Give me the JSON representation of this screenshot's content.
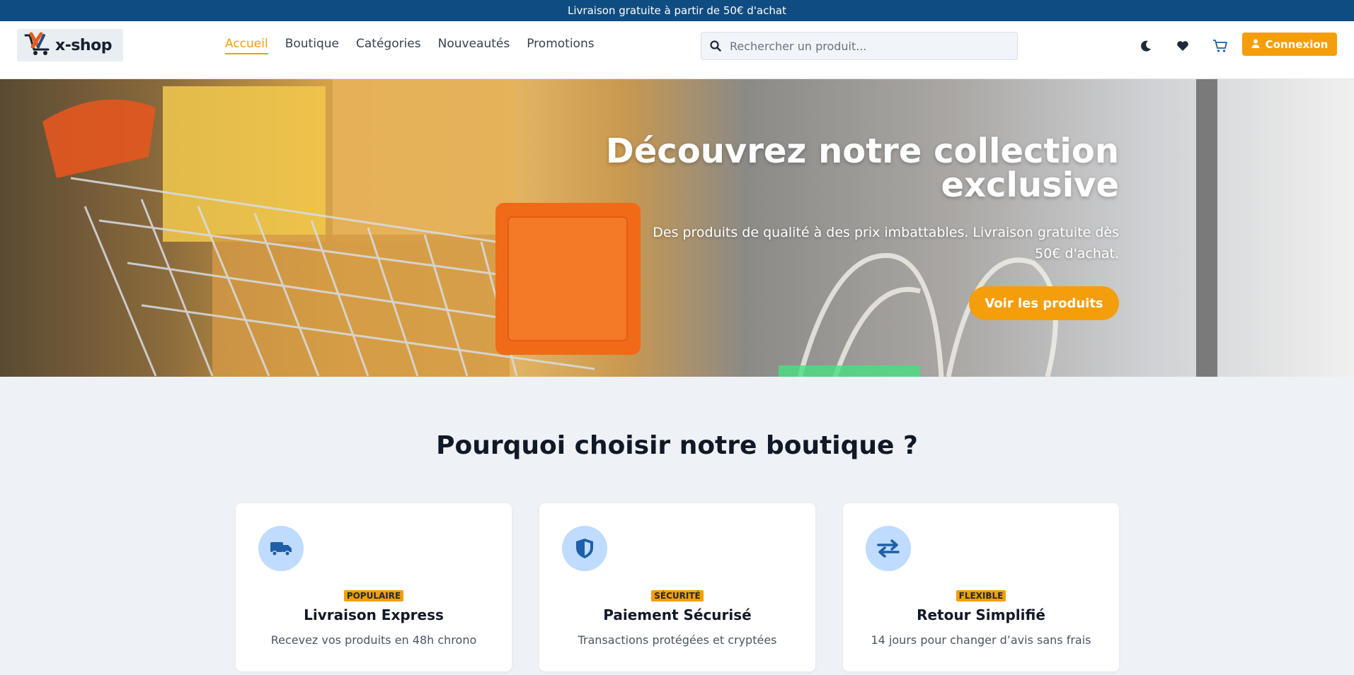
{
  "topbar": {
    "text": "Livraison gratuite à partir de 50€ d'achat"
  },
  "header": {
    "logo_text": "x-shop",
    "nav": [
      "Accueil",
      "Boutique",
      "Catégories",
      "Nouveautés",
      "Promotions"
    ],
    "active_nav": "Accueil",
    "search_placeholder": "Rechercher un produit...",
    "login_label": "Connexion",
    "icons": [
      "moon-icon",
      "heart-icon",
      "cart-icon",
      "user-icon",
      "search-icon"
    ]
  },
  "hero": {
    "title": "Découvrez notre collection exclusive",
    "subtitle": "Des produits de qualité à des prix imbattables. Livraison gratuite dès 50€ d'achat.",
    "cta": "Voir les produits"
  },
  "why": {
    "title": "Pourquoi choisir notre boutique ?",
    "cards": [
      {
        "icon": "truck-icon",
        "badge": "POPULAIRE",
        "title": "Livraison Express",
        "desc": "Recevez vos produits en 48h chrono"
      },
      {
        "icon": "shield-icon",
        "badge": "SÉCURITÉ",
        "title": "Paiement Sécurisé",
        "desc": "Transactions protégées et cryptées"
      },
      {
        "icon": "exchange-icon",
        "badge": "FLEXIBLE",
        "title": "Retour Simplifié",
        "desc": "14 jours pour changer d’avis sans frais"
      }
    ]
  },
  "colors": {
    "accent": "#f59e0b",
    "topbar": "#0f4c81",
    "icon_bg": "#bfdbfe",
    "icon_fg": "#1d5fa8"
  }
}
